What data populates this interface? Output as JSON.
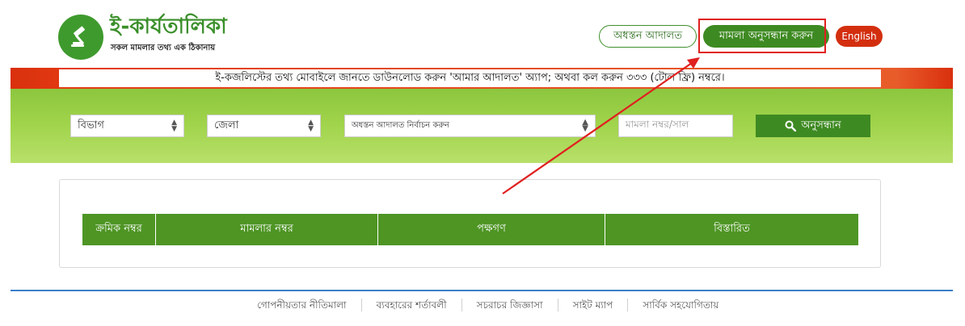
{
  "header": {
    "logo_title": "ই-কার্যতালিকা",
    "logo_subtitle": "সকল মামলার তথ্য এক ঠিকানায়",
    "lower_court_button": "অধস্তন আদালত",
    "case_search_button": "মামলা অনুসন্ধান করুন",
    "language_button": "English"
  },
  "notice": {
    "text": "ই-কজলিস্টের তথ্য মোবাইলে জানতে ডাউনলোড করুন 'আমার আদালত' অ্যাপ; অথবা কল করুন ৩৩৩ (টোল ফ্রি) নম্বরে।"
  },
  "search": {
    "division_select": "বিভাগ",
    "district_select": "জেলা",
    "court_select": "অধস্তন আদালত নির্বাচন করুন",
    "case_input_placeholder": "মামলা নম্বর/সাল",
    "search_button": "অনুসন্ধান"
  },
  "table": {
    "headers": [
      "ক্রমিক নম্বর",
      "মামলার নম্বর",
      "পক্ষগণ",
      "বিস্তারিত"
    ]
  },
  "footer": {
    "links": [
      "গোপনীয়তার নীতিমালা",
      "ব্যবহারের শর্তাবলী",
      "সচরাচর জিজ্ঞাসা",
      "সাইট ম্যাপ",
      "সার্বিক সহযোগিতায়"
    ]
  },
  "colors": {
    "primary_green": "#3e8a22",
    "notice_red": "#d9300e",
    "annotation_red": "#e02020"
  }
}
